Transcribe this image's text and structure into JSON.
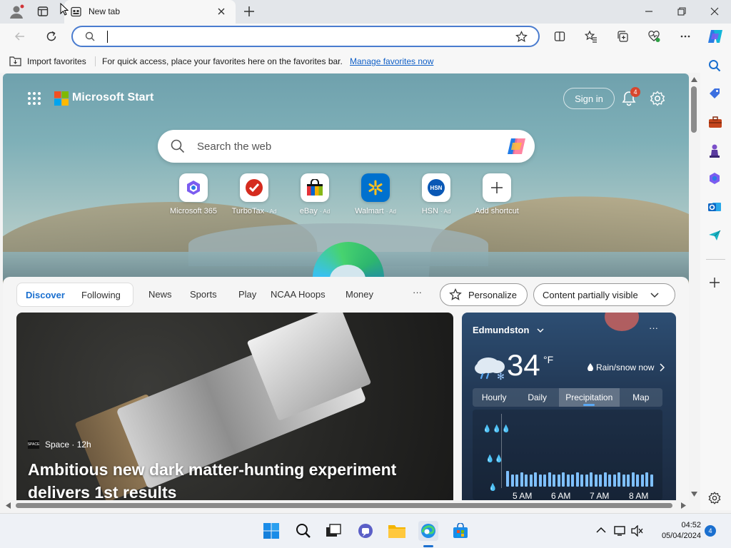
{
  "browser": {
    "tab_title": "New tab",
    "address_value": "",
    "favbar": {
      "import_label": "Import favorites",
      "message": "For quick access, place your favorites here on the favorites bar.",
      "manage_link": "Manage favorites now"
    }
  },
  "page": {
    "brand": "Microsoft Start",
    "sign_in": "Sign in",
    "notification_count": "4",
    "search_placeholder": "Search the web",
    "quick_links": [
      {
        "label": "Microsoft 365",
        "ad": ""
      },
      {
        "label": "TurboTax",
        "ad": "· Ad"
      },
      {
        "label": "eBay",
        "ad": "· Ad"
      },
      {
        "label": "Walmart",
        "ad": "· Ad"
      },
      {
        "label": "HSN",
        "ad": "· Ad"
      },
      {
        "label": "Add shortcut",
        "ad": ""
      }
    ],
    "feed_tabs": {
      "discover": "Discover",
      "following": "Following",
      "news": "News",
      "sports": "Sports",
      "play": "Play",
      "ncaa": "NCAA Hoops",
      "money": "Money",
      "more": "···"
    },
    "personalize": "Personalize",
    "content_visibility": "Content partially visible",
    "hero": {
      "source_logo": "SPACE",
      "source": "Space · 12h",
      "title": "Ambitious new dark matter-hunting experiment delivers 1st results"
    },
    "weather": {
      "city": "Edmundston",
      "temp": "34",
      "unit": "°F",
      "condition": "Rain/snow now",
      "tabs": [
        "Hourly",
        "Daily",
        "Precipitation",
        "Map"
      ],
      "times": [
        "5 AM",
        "6 AM",
        "7 AM",
        "8 AM"
      ]
    }
  },
  "taskbar": {
    "time": "04:52",
    "date": "05/04/2024",
    "notification_count": "4"
  },
  "colors": {
    "accent": "#1a6fcf",
    "link": "#0f5fc7",
    "badge": "#d7462e"
  }
}
